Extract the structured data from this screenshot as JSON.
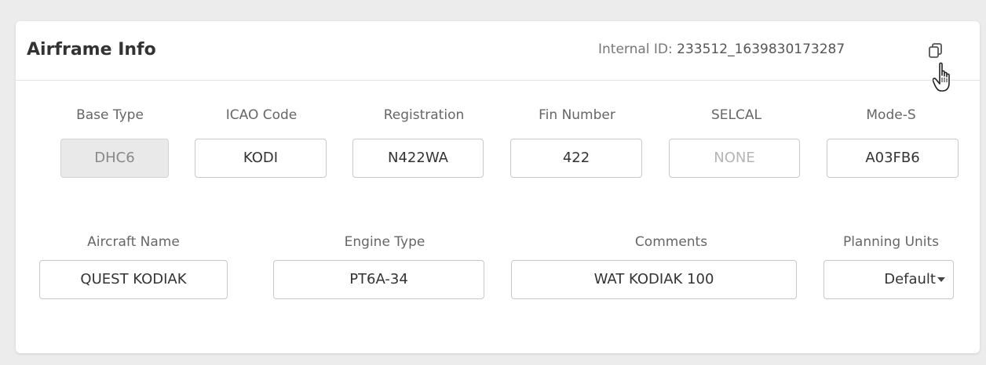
{
  "card": {
    "title": "Airframe Info",
    "internal_id_label": "Internal ID:",
    "internal_id_value": "233512_1639830173287",
    "copy_icon": "copy-icon"
  },
  "row1": [
    {
      "label": "Base Type",
      "value": "DHC6",
      "state": "disabled"
    },
    {
      "label": "ICAO Code",
      "value": "KODI"
    },
    {
      "label": "Registration",
      "value": "N422WA"
    },
    {
      "label": "Fin Number",
      "value": "422"
    },
    {
      "label": "SELCAL",
      "placeholder": "NONE",
      "value": ""
    },
    {
      "label": "Mode-S",
      "value": "A03FB6"
    }
  ],
  "row2": [
    {
      "label": "Aircraft Name",
      "value": "QUEST KODIAK"
    },
    {
      "label": "Engine Type",
      "value": "PT6A-34"
    },
    {
      "label": "Comments",
      "value": "WAT KODIAK 100"
    },
    {
      "label": "Planning Units",
      "value": "Default",
      "type": "select"
    }
  ]
}
